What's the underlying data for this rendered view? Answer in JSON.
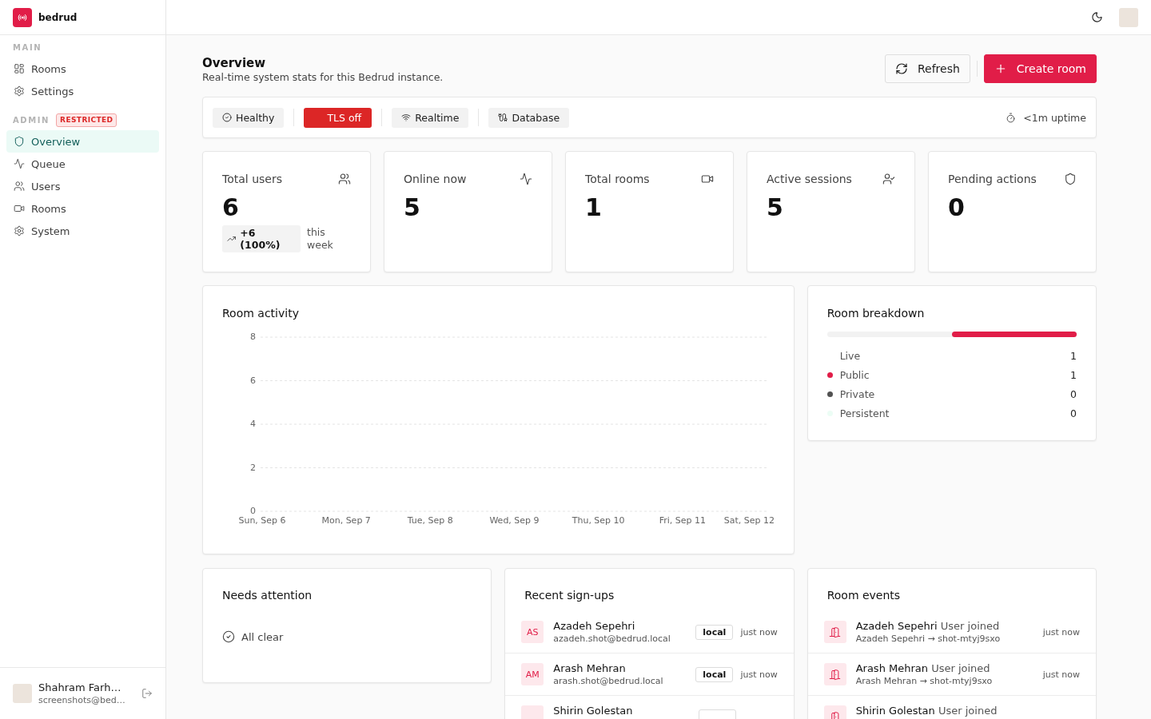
{
  "sidebar": {
    "brand": "bedrud",
    "sections": [
      {
        "label": "MAIN",
        "items": [
          {
            "label": "Rooms",
            "selected": false
          },
          {
            "label": "Settings",
            "selected": false
          }
        ]
      },
      {
        "label": "ADMIN",
        "badge": "RESTRICTED",
        "items": [
          {
            "label": "Overview",
            "selected": true
          },
          {
            "label": "Queue",
            "selected": false
          },
          {
            "label": "Users",
            "selected": false
          },
          {
            "label": "Rooms",
            "selected": false
          },
          {
            "label": "System",
            "selected": false
          }
        ]
      }
    ],
    "user": {
      "name": "Shahram Farh…",
      "email": "screenshots@bed…"
    }
  },
  "header": {
    "title": "Overview",
    "subtitle": "Real-time system stats for this Bedrud instance.",
    "actions": [
      {
        "label": "Refresh",
        "kind": "secondary"
      },
      {
        "label": "Create room",
        "kind": "primary"
      }
    ]
  },
  "status_bar": {
    "chips": [
      {
        "label": "Healthy",
        "kind": "ok"
      },
      {
        "label": "TLS off",
        "kind": "alert"
      },
      {
        "label": "Realtime",
        "kind": "ok"
      },
      {
        "label": "Database",
        "kind": "ok"
      }
    ],
    "uptime": "<1m uptime"
  },
  "stats": [
    {
      "label": "Total users",
      "value": "6",
      "change": "+6 (100%)",
      "change_note": "this week"
    },
    {
      "label": "Online now",
      "value": "5"
    },
    {
      "label": "Total rooms",
      "value": "1"
    },
    {
      "label": "Active sessions",
      "value": "5"
    },
    {
      "label": "Pending actions",
      "value": "0"
    }
  ],
  "room_activity": {
    "title": "Room activity",
    "chart_data": {
      "type": "line",
      "categories": [
        "Sun, Sep 6",
        "Mon, Sep 7",
        "Tue, Sep 8",
        "Wed, Sep 9",
        "Thu, Sep 10",
        "Fri, Sep 11",
        "Sat, Sep 12"
      ],
      "values": [
        null,
        null,
        null,
        null,
        null,
        null,
        null
      ],
      "ylim": [
        0,
        8
      ],
      "yticks": [
        0,
        2,
        4,
        6,
        8
      ],
      "grid": true
    }
  },
  "room_breakdown": {
    "title": "Room breakdown",
    "bar": {
      "level": 0.5
    },
    "items": [
      {
        "label": "Live",
        "count": "1"
      },
      {
        "label": "Public",
        "count": "1",
        "color": "#e11d48"
      },
      {
        "label": "Private",
        "count": "0",
        "color": "#525252"
      },
      {
        "label": "Persistent",
        "count": "0",
        "color": "#ecfdf5"
      }
    ]
  },
  "needs_attention": {
    "title": "Needs attention",
    "message": "All clear"
  },
  "recent_signups": {
    "title": "Recent sign-ups",
    "rows": [
      {
        "initials": "AS",
        "name": "Azadeh Sepehri",
        "email": "azadeh.shot@bedrud.local",
        "provider": "local",
        "time": "just now"
      },
      {
        "initials": "AM",
        "name": "Arash Mehran",
        "email": "arash.shot@bedrud.local",
        "provider": "local",
        "time": "just now"
      },
      {
        "name": "Shirin Golestan"
      }
    ]
  },
  "room_events": {
    "title": "Room events",
    "rows": [
      {
        "actor": "Azadeh Sepehri",
        "action": "User joined",
        "detail": "Azadeh Sepehri → shot-mtyj9sxo",
        "time": "just now"
      },
      {
        "actor": "Arash Mehran",
        "action": "User joined",
        "detail": "Arash Mehran → shot-mtyj9sxo",
        "time": "just now"
      },
      {
        "actor": "Shirin Golestan",
        "action": "User joined"
      }
    ]
  }
}
